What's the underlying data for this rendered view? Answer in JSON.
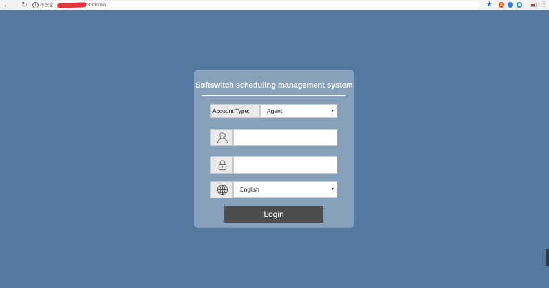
{
  "browser": {
    "back_icon": "arrow-left-icon",
    "forward_icon": "arrow-right-icon",
    "reload_icon": "reload-icon",
    "security_text": "不安全",
    "url_suffix": "28:3000/#/",
    "bookmark_icon": "star-icon",
    "extension_icons": [
      "google-maps-icon",
      "blue-circle-icon",
      "ie-logo-icon",
      "grey-circle-icon",
      "flag-icon"
    ],
    "menu_icon": "kebab-menu-icon"
  },
  "login": {
    "title": "Softswitch scheduling management system",
    "account_type_label": "Account Type:",
    "account_type_value": "Agent",
    "username_value": "",
    "password_value": "",
    "language_value": "English",
    "login_button": "Login"
  },
  "colors": {
    "background": "#54799e",
    "card": "#87a1bc",
    "button": "#4d4d4d"
  }
}
